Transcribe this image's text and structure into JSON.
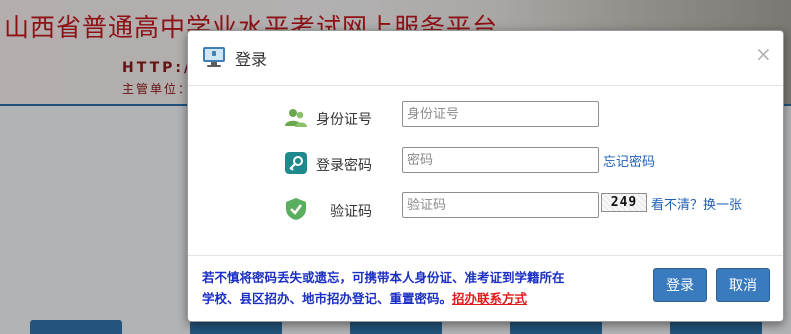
{
  "background": {
    "site_title": "山西省普通高中学业水平考试网上服务平台",
    "url_fragment": "HTTP://",
    "unit_fragment": "主管单位："
  },
  "dialog": {
    "title": "登录",
    "close_glyph": "×",
    "fields": {
      "id": {
        "label": "身份证号",
        "placeholder": "身份证号",
        "value": ""
      },
      "password": {
        "label": "登录密码",
        "placeholder": "密码",
        "value": ""
      },
      "captcha": {
        "label": "验证码",
        "placeholder": "验证码",
        "value": "",
        "image_text": "249"
      }
    },
    "forgot_password": "忘记密码",
    "refresh_captcha": "看不清？换一张",
    "notice_line1": "若不慎将密码丢失或遗忘，可携带本人身份证、准考证到学籍所在",
    "notice_line2": "学校、县区招办、地市招办登记、重置密码。",
    "notice_link": "招办联系方式",
    "buttons": {
      "login": "登录",
      "cancel": "取消"
    }
  },
  "colors": {
    "primary_button": "#3a7bbf",
    "notice_text": "#1b2fc4",
    "notice_link": "#e01b1b",
    "banner_title": "#c2181d"
  },
  "icons": {
    "header": "monitor-icon",
    "id_row": "users-icon",
    "password_row": "key-icon",
    "captcha_row": "shield-check-icon"
  }
}
